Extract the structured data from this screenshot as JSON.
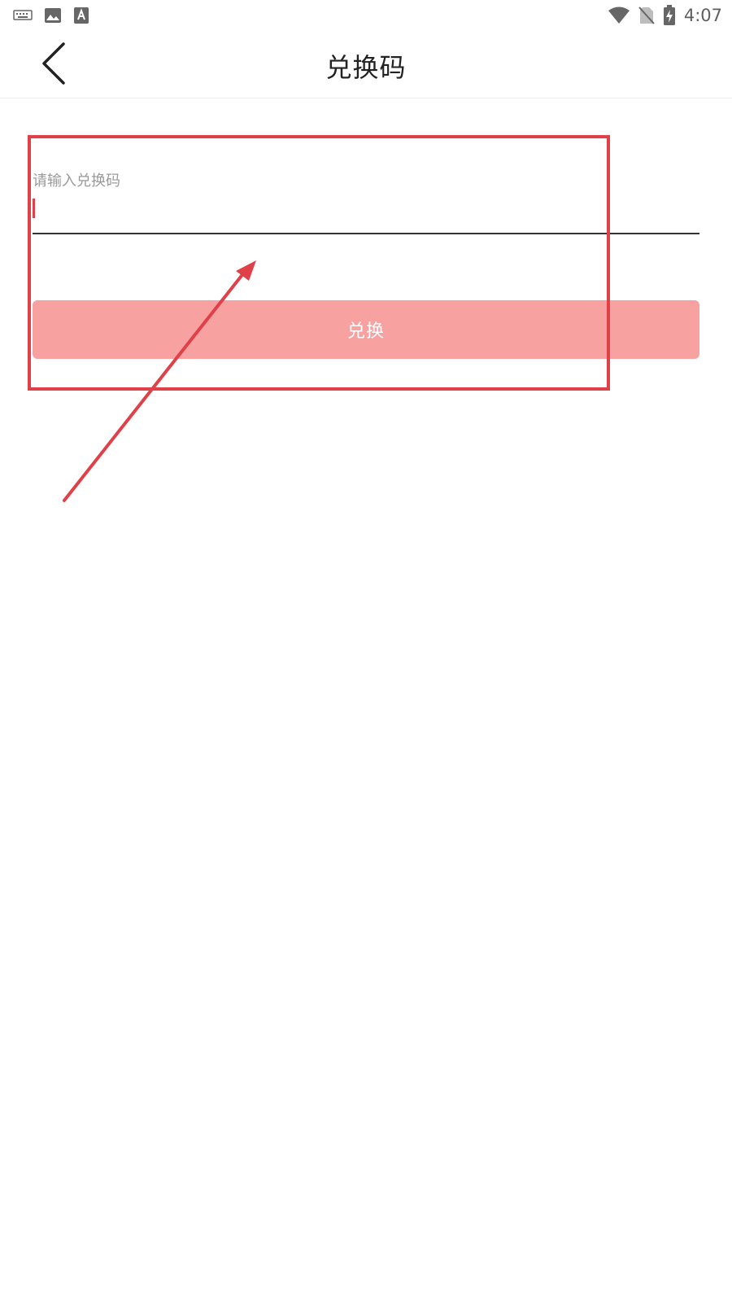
{
  "status_bar": {
    "time": "4:07",
    "left_icons": [
      "keyboard-icon",
      "image-icon",
      "text-a-icon"
    ],
    "right_icons": [
      "wifi-icon",
      "no-sim-icon",
      "battery-charging-icon"
    ]
  },
  "app_bar": {
    "title": "兑换码",
    "back_icon": "chevron-left-icon"
  },
  "form": {
    "label": "请输入兑换码",
    "input_value": "",
    "submit_label": "兑换"
  },
  "colors": {
    "accent": "#e04048",
    "button_bg": "#f7a2a0",
    "button_text": "#ffffff",
    "label": "#9a9a9a",
    "title": "#222222",
    "underline": "#333333"
  }
}
